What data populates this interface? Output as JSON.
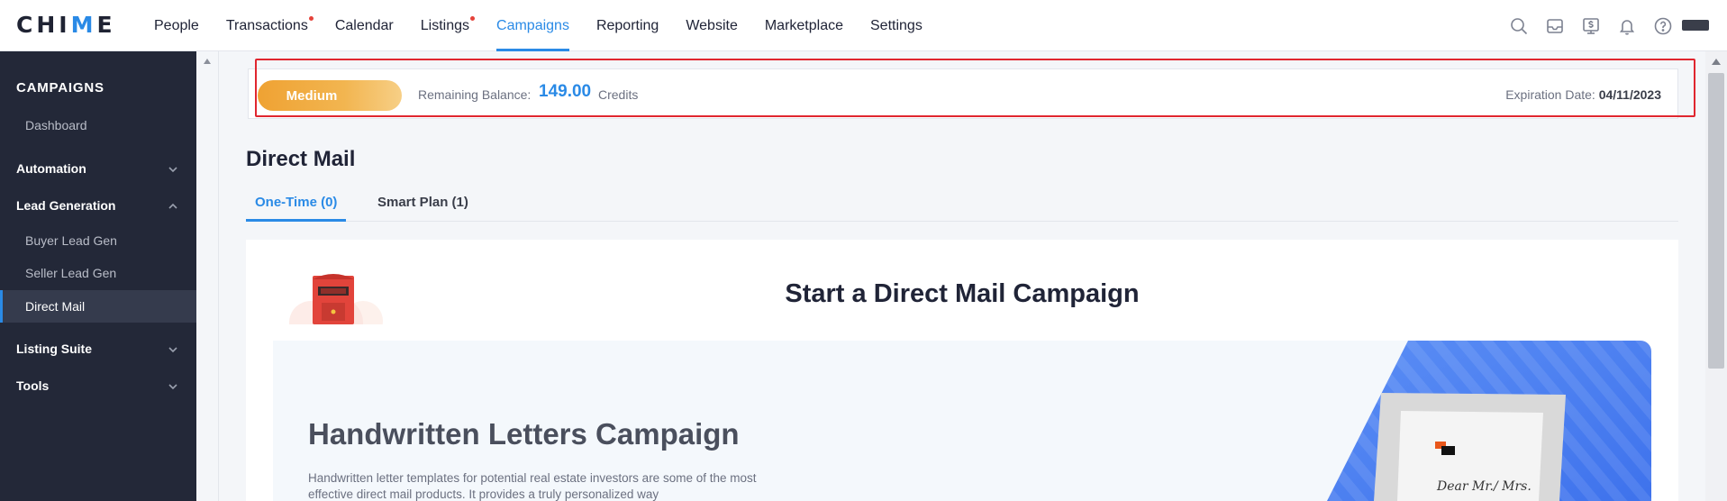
{
  "app": {
    "logo_text_a": "CHI",
    "logo_text_b": "M",
    "logo_text_c": "E"
  },
  "nav": {
    "items": [
      {
        "label": "People",
        "dot": false,
        "active": false
      },
      {
        "label": "Transactions",
        "dot": true,
        "active": false
      },
      {
        "label": "Calendar",
        "dot": false,
        "active": false
      },
      {
        "label": "Listings",
        "dot": true,
        "active": false
      },
      {
        "label": "Campaigns",
        "dot": false,
        "active": true
      },
      {
        "label": "Reporting",
        "dot": false,
        "active": false
      },
      {
        "label": "Website",
        "dot": false,
        "active": false
      },
      {
        "label": "Marketplace",
        "dot": false,
        "active": false
      },
      {
        "label": "Settings",
        "dot": false,
        "active": false
      }
    ],
    "icons": [
      "search-icon",
      "inbox-icon",
      "billing-icon",
      "bell-icon",
      "help-icon"
    ]
  },
  "sidebar": {
    "title": "CAMPAIGNS",
    "dashboard": "Dashboard",
    "automation": "Automation",
    "lead_generation": "Lead Generation",
    "buyer_lead_gen": "Buyer Lead Gen",
    "seller_lead_gen": "Seller Lead Gen",
    "direct_mail": "Direct Mail",
    "listing_suite": "Listing Suite",
    "tools": "Tools"
  },
  "balance": {
    "plan": "Medium",
    "label": "Remaining Balance:",
    "value": "149.00",
    "unit": "Credits",
    "expiration_label": "Expiration Date:",
    "expiration_value": "04/11/2023"
  },
  "page": {
    "title": "Direct Mail",
    "tabs": {
      "one_time": "One-Time (0)",
      "smart_plan": "Smart Plan (1)"
    }
  },
  "card": {
    "title": "Start a Direct Mail Campaign",
    "inner_title": "Handwritten Letters Campaign",
    "inner_desc": "Handwritten letter templates for potential real estate investors are some of the most effective direct mail products. It provides a truly personalized way",
    "letter_text": "Dear Mr./ Mrs."
  },
  "colors": {
    "accent": "#2a8ae6",
    "sidebar_bg": "#232838",
    "plan_badge": "#efa233",
    "highlight": "#e0262f"
  }
}
